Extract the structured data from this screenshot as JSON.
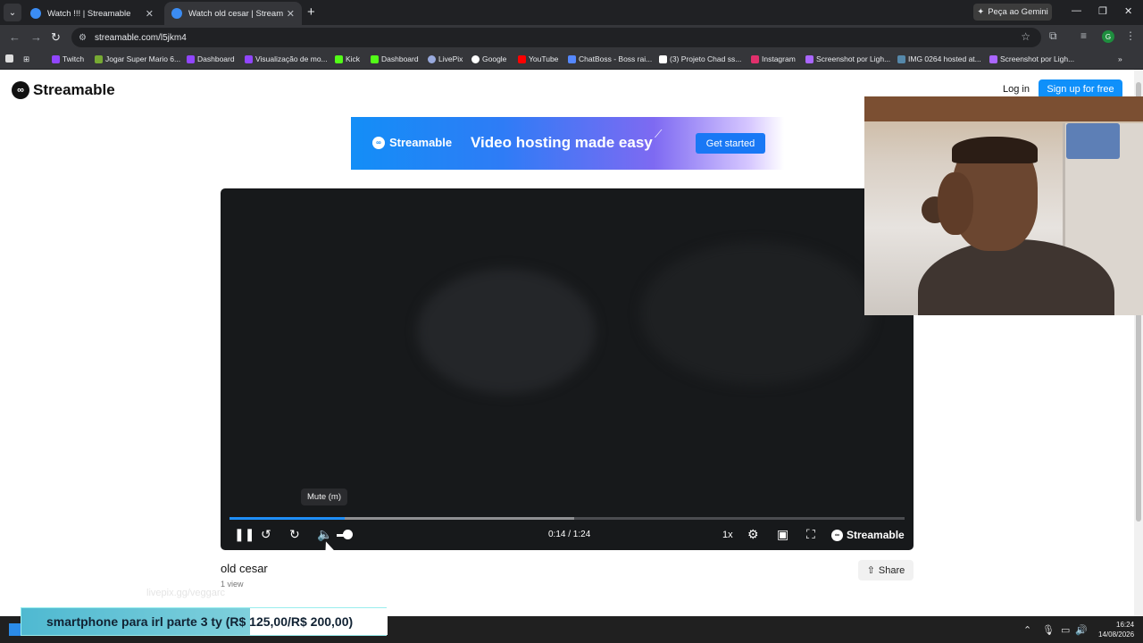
{
  "browser": {
    "tabs": [
      {
        "title": "Watch !!! | Streamable",
        "close": "✕"
      },
      {
        "title": "Watch old cesar | Streamable",
        "close": "✕"
      }
    ],
    "new_tab": "+",
    "gemini": "Peça ao Gemini",
    "url": "streamable.com/l5jkm4",
    "profile_initial": "G",
    "bookmarks": [
      {
        "label": "Twitch",
        "color": "#9146ff"
      },
      {
        "label": "Jogar Super Mario 6...",
        "color": "#7a3"
      },
      {
        "label": "Dashboard",
        "color": "#9146ff"
      },
      {
        "label": "Visualização de mo...",
        "color": "#9146ff"
      },
      {
        "label": "Kick",
        "color": "#53fc18"
      },
      {
        "label": "Dashboard",
        "color": "#53fc18"
      },
      {
        "label": "LivePix",
        "color": "#9ad"
      },
      {
        "label": "Google",
        "color": "#fff"
      },
      {
        "label": "YouTube",
        "color": "#f00"
      },
      {
        "label": "ChatBoss - Boss rai...",
        "color": "#58f"
      },
      {
        "label": "(3) Projeto Chad ss...",
        "color": "#fff"
      },
      {
        "label": "Instagram",
        "color": "#e1306c"
      },
      {
        "label": "Screenshot por Ligh...",
        "color": "#a6f"
      },
      {
        "label": "IMG 0264 hosted at...",
        "color": "#58a"
      },
      {
        "label": "Screenshot por Ligh...",
        "color": "#a6f"
      }
    ]
  },
  "site": {
    "logo_text": "Streamable",
    "login": "Log in",
    "signup": "Sign up for free"
  },
  "banner": {
    "brand": "Streamable",
    "tagline": "Video hosting made easy",
    "cta": "Get started"
  },
  "player": {
    "tooltip": "Mute (m)",
    "time": "0:14 / 1:24",
    "speed": "1x",
    "brand": "Streamable",
    "progress": 0.17,
    "buffered": 0.51,
    "volume": 0.5
  },
  "video": {
    "title": "old cesar",
    "views": "1 view",
    "share": "Share"
  },
  "overlay": {
    "watermark": "livepix.gg/veggarc",
    "text": "smartphone para irl parte 3 ty (R$ 125,00/R$ 200,00)"
  },
  "taskbar": {
    "time": "16:24",
    "date": "14/08/2026"
  }
}
